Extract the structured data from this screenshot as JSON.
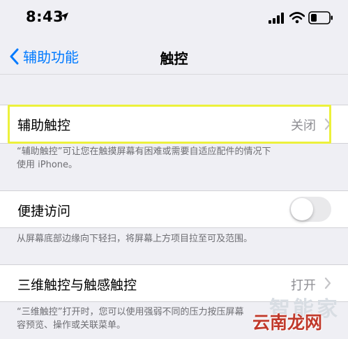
{
  "status": {
    "time": "8:43"
  },
  "nav": {
    "back_label": "辅助功能",
    "title": "触控"
  },
  "assistive_touch": {
    "label": "辅助触控",
    "value": "关闭",
    "footer_line1": "“辅助触控”可让您在触摸屏幕有困难或需要自适应配件的情况下",
    "footer_line2": "使用 iPhone。"
  },
  "reachability": {
    "label": "便捷访问",
    "enabled": false,
    "footer": "从屏幕底部边缘向下轻扫，将屏幕上方项目拉至可及范围。"
  },
  "touch_3d": {
    "label": "三维触控与触感触控",
    "value": "打开",
    "footer_line1": "“三维触控”打开时，您可以使用强弱不同的压力按压屏幕",
    "footer_line2": "容预览、操作或关联菜单。"
  },
  "watermark": {
    "top": "智能家",
    "bottom": "云南龙网"
  },
  "colors": {
    "accent": "#007aff",
    "highlight": "#ecf13b",
    "background": "#efeff4"
  }
}
